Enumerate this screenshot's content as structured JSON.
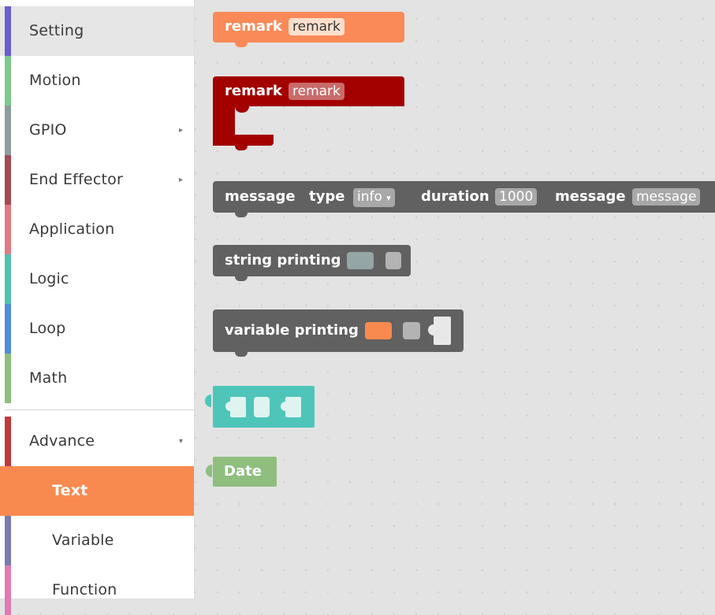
{
  "sidebar": {
    "items": [
      {
        "label": "Setting",
        "color": "#6a5fce",
        "arrow": ""
      },
      {
        "label": "Motion",
        "color": "#7cc98c",
        "arrow": ""
      },
      {
        "label": "GPIO",
        "color": "#8d9e9c",
        "arrow": "▸"
      },
      {
        "label": "End Effector",
        "color": "#a34a55",
        "arrow": "▸"
      },
      {
        "label": "Application",
        "color": "#e07a84",
        "arrow": ""
      },
      {
        "label": "Logic",
        "color": "#4fc1b2",
        "arrow": ""
      },
      {
        "label": "Loop",
        "color": "#4f8fd6",
        "arrow": ""
      },
      {
        "label": "Math",
        "color": "#8fbe7e",
        "arrow": ""
      },
      {
        "label": "Advance",
        "color": "#c0393b",
        "arrow": "▾"
      },
      {
        "label": "Text",
        "color": "#f98a4f",
        "arrow": ""
      },
      {
        "label": "Variable",
        "color": "#7c7bb0",
        "arrow": ""
      },
      {
        "label": "Function",
        "color": "#e17bb3",
        "arrow": ""
      }
    ]
  },
  "blocks": {
    "remark1": {
      "label": "remark",
      "field": "remark",
      "color": "#fa8a58",
      "field_color": "#fde0cc"
    },
    "remark2": {
      "label": "remark",
      "field": "remark",
      "color": "#a30000",
      "field_color": "#c96b6b"
    },
    "message": {
      "label": "message",
      "type_label": "type",
      "type_value": "info",
      "type_arrow": "▾",
      "duration_label": "duration",
      "duration_value": "1000",
      "message_label": "message",
      "message_value": "message",
      "color": "#616161",
      "field_color": "#a8a8a8"
    },
    "string_printing": {
      "label": "string printing",
      "color": "#616161",
      "slot1_color": "#94a6a6",
      "slot2_color": "#b3b3b3"
    },
    "variable_printing": {
      "label": "variable printing",
      "color": "#616161",
      "slot1_color": "#f98a4f",
      "slot2_color": "#b3b3b3"
    },
    "teal_join": {
      "color": "#4fc5b9"
    },
    "date": {
      "label": "Date",
      "color": "#8fbe7e"
    }
  }
}
